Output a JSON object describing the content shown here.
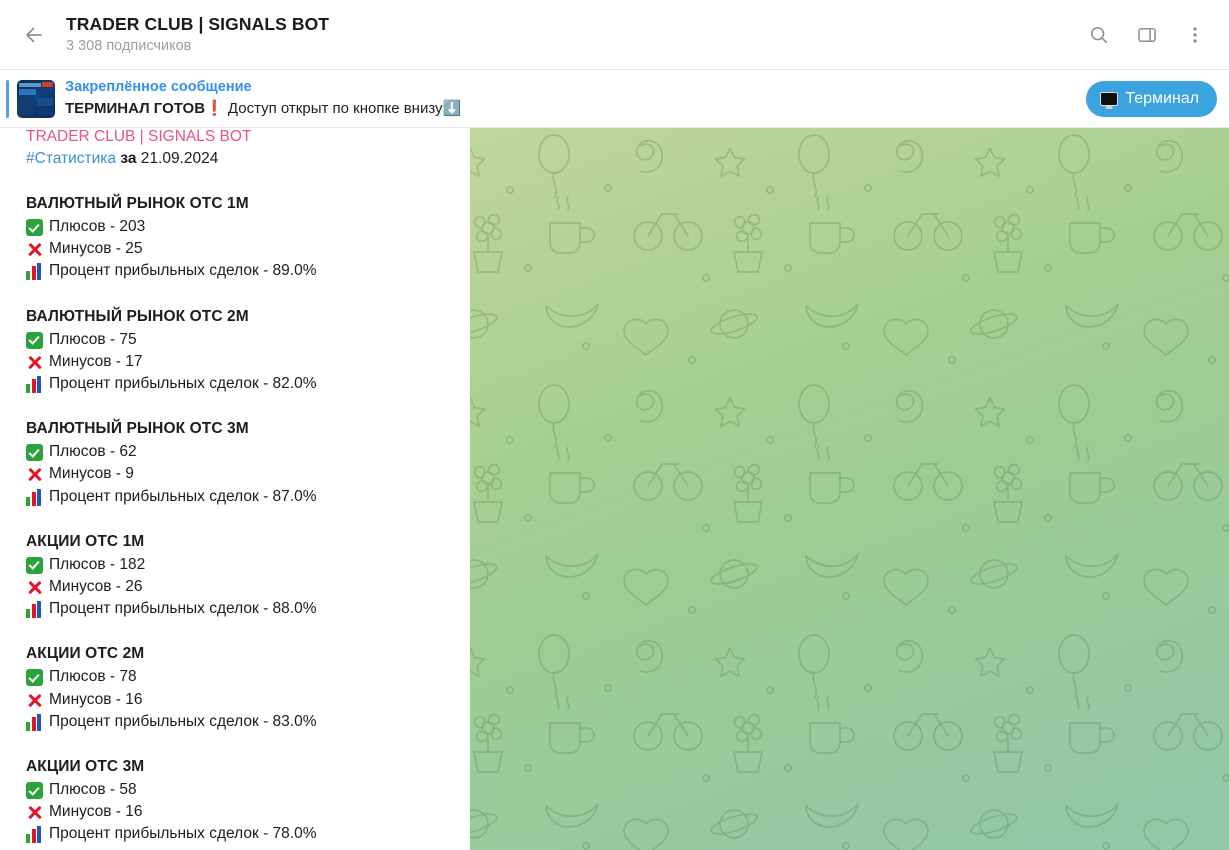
{
  "header": {
    "back_icon": "back-arrow-icon",
    "title": "TRADER CLUB | SIGNALS BOT",
    "subscribers": "3 308 подписчиков",
    "actions": [
      {
        "name": "search-icon",
        "label": "Поиск"
      },
      {
        "name": "sidebar-toggle-icon",
        "label": "Панель"
      },
      {
        "name": "more-options-icon",
        "label": "Ещё"
      }
    ]
  },
  "pinned": {
    "label": "Закреплённое сообщение",
    "message_bold": "ТЕРМИНАЛ ГОТОВ",
    "message_emoji": "❗",
    "message_rest": "Доступ открыт по кнопке внизу",
    "message_arrow": "⬇️",
    "thumb_icon": "pinned-photo-thumbnail",
    "terminal_button": "Терминал",
    "terminal_icon": "desktop-computer-icon",
    "accent_color": "#4ca3e0",
    "button_color": "#3ba3e0"
  },
  "message": {
    "channel_line": "TRADER CLUB | SIGNALS BOT",
    "hashtag": "#Статистика",
    "date_prefix": "за",
    "date": "21.09.2024",
    "labels": {
      "plus": "Плюсов",
      "minus": "Минусов",
      "percent": "Процент прибыльных сделок"
    },
    "groups": [
      {
        "title": "ВАЛЮТНЫЙ РЫНОК OTC 1М",
        "plus": "Плюсов - 203",
        "minus": "Минусов - 25",
        "percent": "Процент прибыльных сделок - 89.0%"
      },
      {
        "title": "ВАЛЮТНЫЙ РЫНОК OTC 2М",
        "plus": "Плюсов - 75",
        "minus": "Минусов - 17",
        "percent": "Процент прибыльных сделок - 82.0%"
      },
      {
        "title": "ВАЛЮТНЫЙ РЫНОК OTC 3М",
        "plus": "Плюсов - 62",
        "minus": "Минусов - 9",
        "percent": "Процент прибыльных сделок - 87.0%"
      },
      {
        "title": "АКЦИИ OTC 1М",
        "plus": "Плюсов - 182",
        "minus": "Минусов - 26",
        "percent": "Процент прибыльных сделок - 88.0%"
      },
      {
        "title": "АКЦИИ OTC 2М",
        "plus": "Плюсов - 78",
        "minus": "Минусов - 16",
        "percent": "Процент прибыльных сделок - 83.0%"
      },
      {
        "title": "АКЦИИ OTC 3М",
        "plus": "Плюсов - 58",
        "minus": "Минусов - 16",
        "percent": "Процент прибыльных сделок - 78.0%"
      }
    ]
  },
  "colors": {
    "accent_blue": "#3390ec",
    "channel_pink": "#e9508c",
    "hashtag_blue": "#3a8fd0",
    "wallpaper_top": "#cfdda6",
    "wallpaper_bottom": "#93c7a6"
  }
}
